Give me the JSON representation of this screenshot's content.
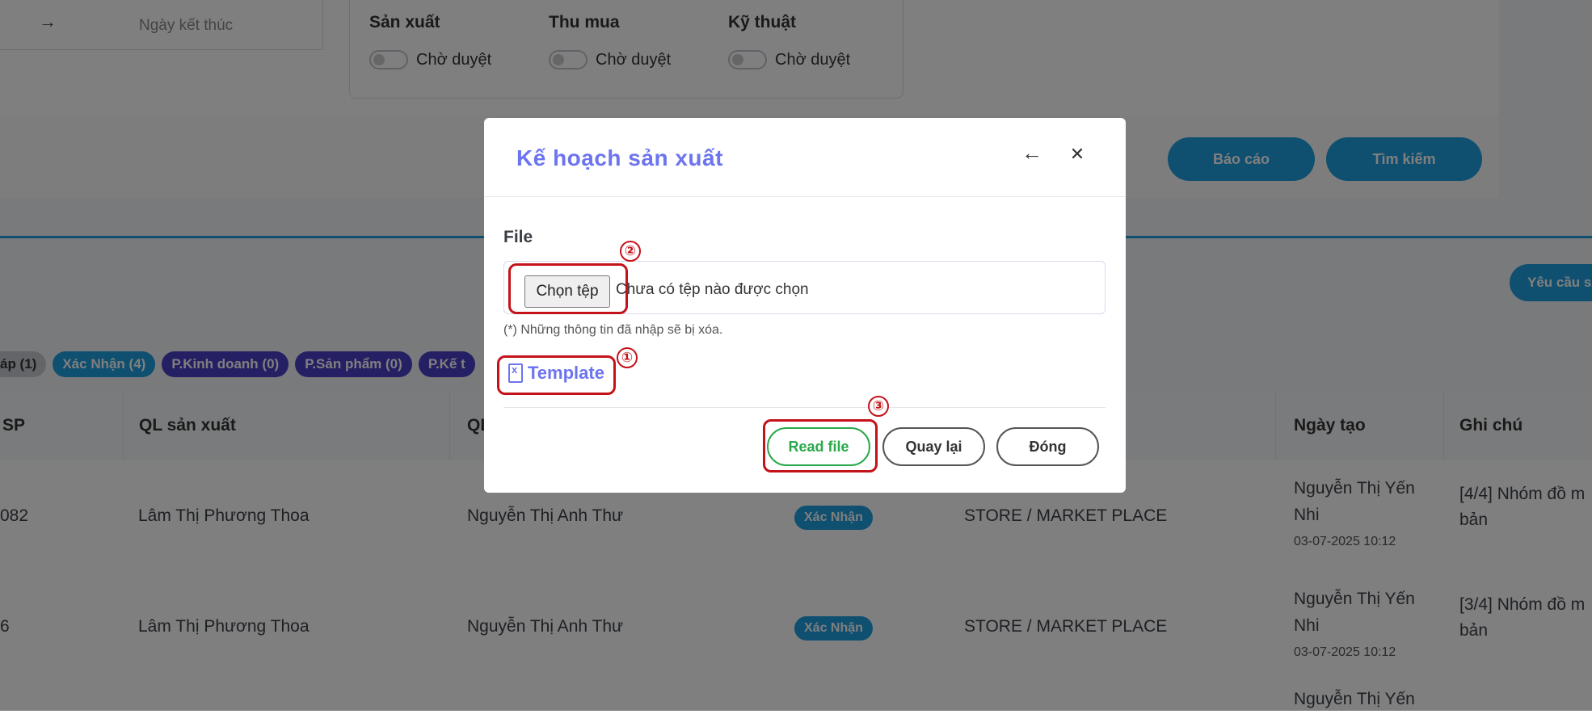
{
  "filters": {
    "date_arrow": "→",
    "end_date_placeholder": "Ngày kết thúc",
    "approvals": [
      {
        "title": "Sản xuất",
        "status": "Chờ duyệt"
      },
      {
        "title": "Thu mua",
        "status": "Chờ duyệt"
      },
      {
        "title": "Kỹ thuật",
        "status": "Chờ duyệt"
      }
    ],
    "report_label": "Báo cáo",
    "search_label": "Tìm kiếm"
  },
  "request_button_label": "Yêu cầu s",
  "status_tags": [
    {
      "label": "áp (1)",
      "color": "#c8cbd2",
      "text_color": "#333333"
    },
    {
      "label": "Xác Nhận (4)",
      "color": "#1e9fe0",
      "text_color": "#ffffff"
    },
    {
      "label": "P.Kinh doanh (0)",
      "color": "#4b3fc7",
      "text_color": "#ffffff"
    },
    {
      "label": "P.Sản phẩm (0)",
      "color": "#4b3fc7",
      "text_color": "#ffffff"
    },
    {
      "label": "P.Kế t",
      "color": "#4b3fc7",
      "text_color": "#ffffff"
    }
  ],
  "table": {
    "headers": [
      "SP",
      "QL sản xuất",
      "QL",
      "",
      "",
      "Ngày tạo",
      "Ghi chú"
    ],
    "rows": [
      {
        "code": "082",
        "ql_san_xuat": "Lâm Thị Phương Thoa",
        "ql": "Nguyễn Thị Anh Thư",
        "status": "Xác Nhận",
        "channel": "STORE / MARKET PLACE",
        "creator_line1": "Nguyễn Thị Yến",
        "creator_line2": "Nhi",
        "created_at": "03-07-2025 10:12",
        "note_line1": "[4/4] Nhóm đồ m",
        "note_line2": "bản"
      },
      {
        "code": "6",
        "ql_san_xuat": "Lâm Thị Phương Thoa",
        "ql": "Nguyễn Thị Anh Thư",
        "status": "Xác Nhận",
        "channel": "STORE / MARKET PLACE",
        "creator_line1": "Nguyễn Thị Yến",
        "creator_line2": "Nhi",
        "created_at": "03-07-2025 10:12",
        "note_line1": "[3/4] Nhóm đồ m",
        "note_line2": "bản"
      }
    ],
    "partial_row_text": "Nguyễn Thị Yến"
  },
  "modal": {
    "title": "Kế hoạch sản xuất",
    "back_icon": "←",
    "close_icon": "✕",
    "file_label": "File",
    "choose_file_label": "Chọn tệp",
    "no_file_text": "Chưa có tệp nào được chọn",
    "note": "(*) Những thông tin đã nhập sẽ bị xóa.",
    "template_label": "Template",
    "read_file_label": "Read file",
    "back_label": "Quay lại",
    "close_label": "Đóng"
  },
  "annotations": [
    "①",
    "②",
    "③"
  ],
  "colors": {
    "accent": "#6c74f0",
    "primary": "#1e9fe0",
    "success": "#2aa84a",
    "annotation": "#c4121a"
  }
}
